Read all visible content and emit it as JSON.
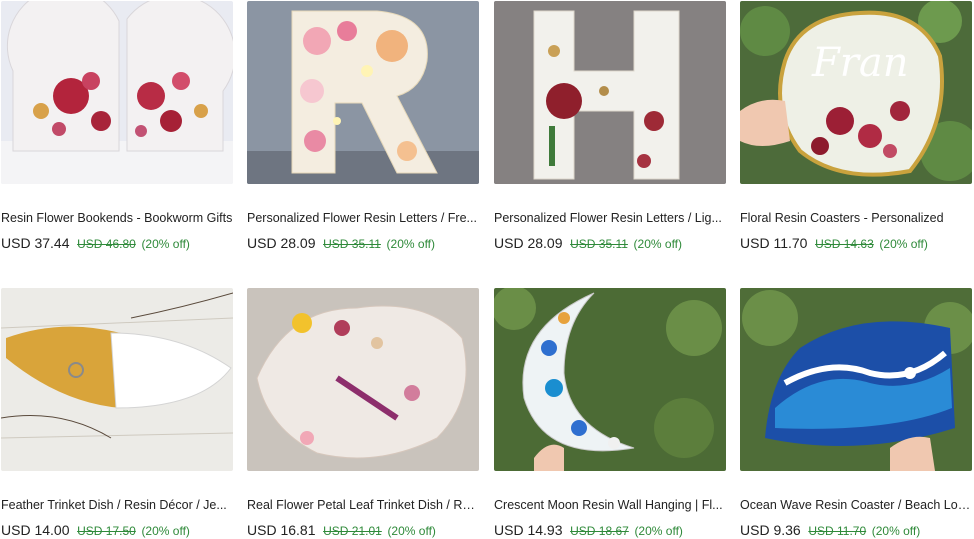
{
  "listings": [
    {
      "title": "Resin Flower Bookends - Bookworm Gifts",
      "price": "USD 37.44",
      "original_price": "USD 46.80",
      "discount": "(20% off)"
    },
    {
      "title": "Personalized Flower Resin Letters / Fre...",
      "price": "USD 28.09",
      "original_price": "USD 35.11",
      "discount": "(20% off)"
    },
    {
      "title": "Personalized Flower Resin Letters / Lig...",
      "price": "USD 28.09",
      "original_price": "USD 35.11",
      "discount": "(20% off)"
    },
    {
      "title": "Floral Resin Coasters - Personalized",
      "price": "USD 11.70",
      "original_price": "USD 14.63",
      "discount": "(20% off)"
    },
    {
      "title": "Feather Trinket Dish / Resin Décor / Je...",
      "price": "USD 14.00",
      "original_price": "USD 17.50",
      "discount": "(20% off)"
    },
    {
      "title": "Real Flower Petal Leaf Trinket Dish / Re...",
      "price": "USD 16.81",
      "original_price": "USD 21.01",
      "discount": "(20% off)"
    },
    {
      "title": "Crescent Moon Resin Wall Hanging | Fl...",
      "price": "USD 14.93",
      "original_price": "USD 18.67",
      "discount": "(20% off)"
    },
    {
      "title": "Ocean Wave Resin Coaster / Beach Lov...",
      "price": "USD 9.36",
      "original_price": "USD 11.70",
      "discount": "(20% off)"
    }
  ],
  "images": {
    "coaster_text": "Fran"
  },
  "colors": {
    "discount_green": "#2f8a3a",
    "text": "#222222"
  }
}
